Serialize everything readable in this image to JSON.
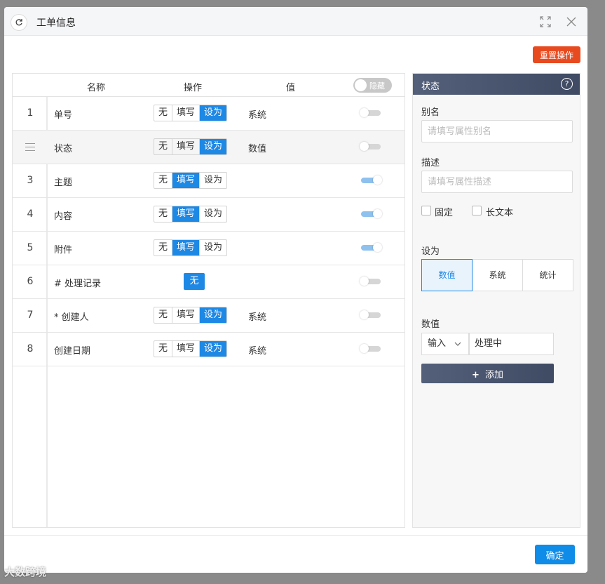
{
  "dialog": {
    "title": "工单信息",
    "reset_label": "重置操作",
    "ok_label": "确定"
  },
  "table": {
    "headers": {
      "name": "名称",
      "op": "操作",
      "value": "值"
    },
    "hide_toggle_label": "隐藏",
    "rows": [
      {
        "index": "1",
        "name": "单号",
        "ops": [
          "无",
          "填写",
          "设为"
        ],
        "active": "设为",
        "value": "系统",
        "visible": false
      },
      {
        "index": "",
        "name": "状态",
        "ops": [
          "无",
          "填写",
          "设为"
        ],
        "active": "设为",
        "value": "数值",
        "visible": false
      },
      {
        "index": "3",
        "name": "主题",
        "ops": [
          "无",
          "填写",
          "设为"
        ],
        "active": "填写",
        "value": "",
        "visible": true
      },
      {
        "index": "4",
        "name": "内容",
        "ops": [
          "无",
          "填写",
          "设为"
        ],
        "active": "填写",
        "value": "",
        "visible": true
      },
      {
        "index": "5",
        "name": "附件",
        "ops": [
          "无",
          "填写",
          "设为"
        ],
        "active": "填写",
        "value": "",
        "visible": true
      },
      {
        "index": "6",
        "name": "# 处理记录",
        "ops": [
          "无"
        ],
        "active": "无",
        "value": "",
        "visible": false
      },
      {
        "index": "7",
        "name": "* 创建人",
        "ops": [
          "无",
          "填写",
          "设为"
        ],
        "active": "设为",
        "value": "系统",
        "visible": false
      },
      {
        "index": "8",
        "name": "创建日期",
        "ops": [
          "无",
          "填写",
          "设为"
        ],
        "active": "设为",
        "value": "系统",
        "visible": false
      }
    ]
  },
  "panel": {
    "title": "状态",
    "help": "?",
    "alias_label": "别名",
    "alias_placeholder": "请填写属性别名",
    "desc_label": "描述",
    "desc_placeholder": "请填写属性描述",
    "fixed_label": "固定",
    "longtext_label": "长文本",
    "set_label": "设为",
    "set_options": [
      "数值",
      "系统",
      "统计"
    ],
    "set_active": "数值",
    "value_label": "数值",
    "input_type": "输入",
    "input_value": "处理中",
    "add_label": "添加",
    "add_icon": "+"
  },
  "watermark": "大数跨境"
}
